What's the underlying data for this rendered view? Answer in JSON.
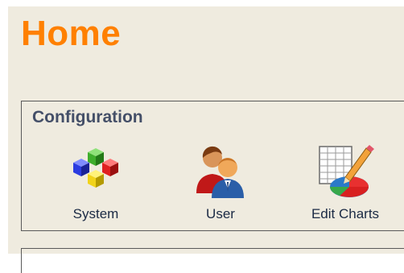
{
  "page": {
    "title": "Home"
  },
  "configuration": {
    "heading": "Configuration",
    "items": [
      {
        "label": "System",
        "icon": "colored-cubes-icon"
      },
      {
        "label": "User",
        "icon": "users-icon"
      },
      {
        "label": "Edit Charts",
        "icon": "edit-charts-icon"
      }
    ]
  },
  "colors": {
    "title": "#ff8000",
    "heading": "#444f68",
    "background": "#efebdf"
  }
}
